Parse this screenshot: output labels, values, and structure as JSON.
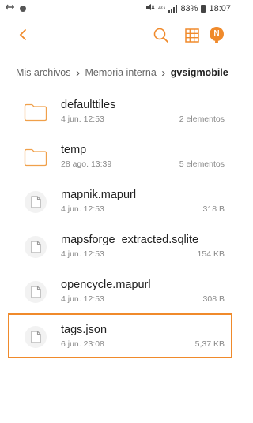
{
  "status_bar": {
    "network": "4G",
    "battery": "83%",
    "time": "18:07"
  },
  "toolbar": {
    "back_icon": "chevron-left-icon",
    "search_icon": "search-icon",
    "view_icon": "grid-icon",
    "notification_badge": "N",
    "accent_color": "#f08a2b"
  },
  "breadcrumb": {
    "items": [
      "Mis archivos",
      "Memoria interna",
      "gvsigmobile"
    ]
  },
  "files": [
    {
      "name": "defaulttiles",
      "date": "4 jun. 12:53",
      "meta": "2 elementos",
      "type": "folder"
    },
    {
      "name": "temp",
      "date": "28 ago. 13:39",
      "meta": "5 elementos",
      "type": "folder"
    },
    {
      "name": "mapnik.mapurl",
      "date": "4 jun. 12:53",
      "meta": "318 B",
      "type": "file"
    },
    {
      "name": "mapsforge_extracted.sqlite",
      "date": "4 jun. 12:53",
      "meta": "154 KB",
      "type": "file"
    },
    {
      "name": "opencycle.mapurl",
      "date": "4 jun. 12:53",
      "meta": "308 B",
      "type": "file"
    },
    {
      "name": "tags.json",
      "date": "6 jun. 23:08",
      "meta": "5,37 KB",
      "type": "file",
      "selected": true
    }
  ]
}
